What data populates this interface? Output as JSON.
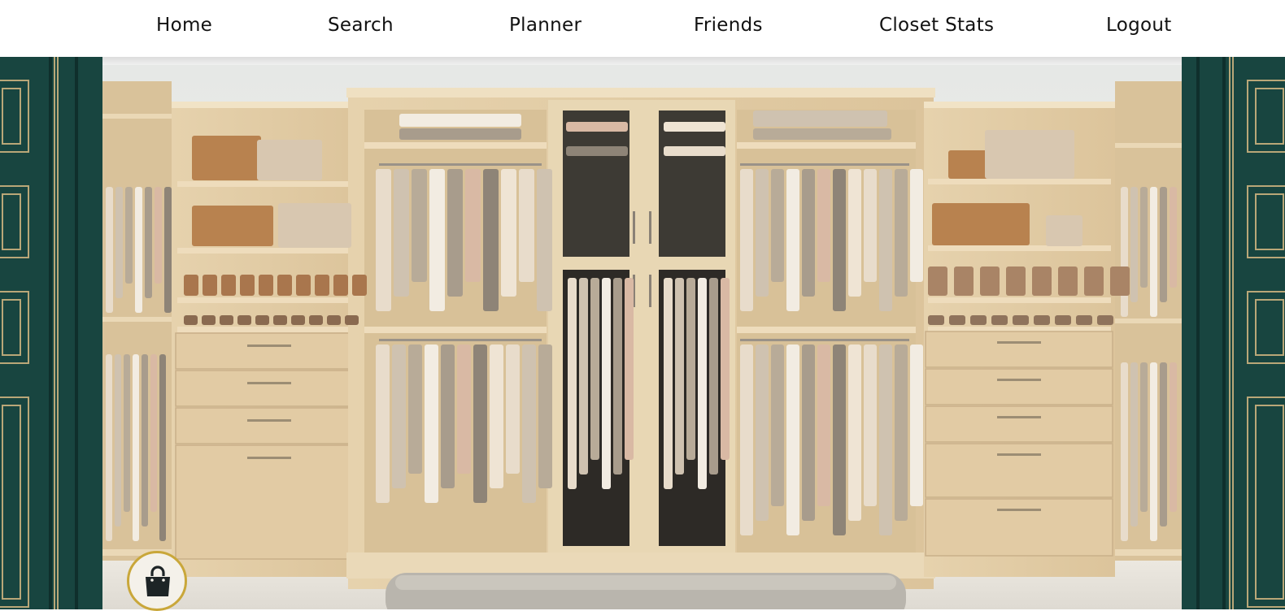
{
  "nav": {
    "items": [
      {
        "label": "Home"
      },
      {
        "label": "Search"
      },
      {
        "label": "Planner"
      },
      {
        "label": "Friends"
      },
      {
        "label": "Closet Stats"
      },
      {
        "label": "Logout"
      }
    ]
  },
  "theme": {
    "side_panel_color": "#184540",
    "trim_color": "#b9a778",
    "wood_color": "#e3cfa9",
    "bag_button_ring": "#c9a73a"
  },
  "fab": {
    "icon": "shopping-bag-icon"
  }
}
